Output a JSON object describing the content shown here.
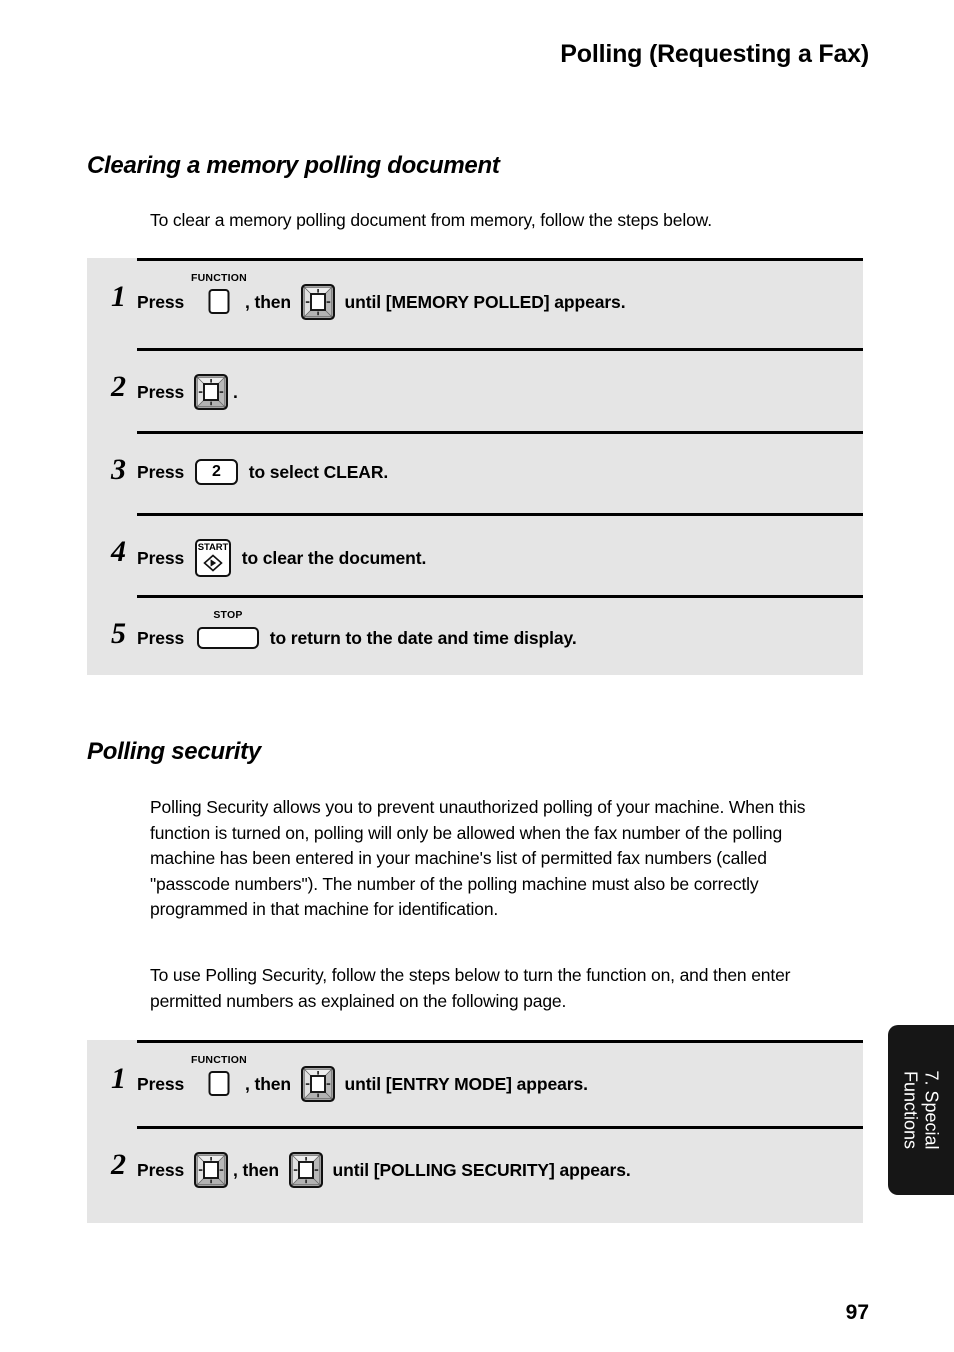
{
  "header": {
    "title": "Polling (Requesting a Fax)"
  },
  "sections": {
    "clearing": {
      "heading": "Clearing a memory polling document",
      "intro": "To clear a memory polling document from memory, follow the steps below.",
      "steps": [
        {
          "number": "1",
          "parts": [
            {
              "kind": "text",
              "value": "Press "
            },
            {
              "kind": "key",
              "icon": "function-key",
              "label": "FUNCTION"
            },
            {
              "kind": "text",
              "value": ", then "
            },
            {
              "kind": "key",
              "icon": "nav-key"
            },
            {
              "kind": "text",
              "value": " until [MEMORY POLLED] appears."
            }
          ]
        },
        {
          "number": "2",
          "parts": [
            {
              "kind": "text",
              "value": "Press "
            },
            {
              "kind": "key",
              "icon": "nav-key"
            },
            {
              "kind": "text",
              "value": "."
            }
          ]
        },
        {
          "number": "3",
          "parts": [
            {
              "kind": "text",
              "value": "Press "
            },
            {
              "kind": "key",
              "icon": "numeric-key",
              "label": "2"
            },
            {
              "kind": "text",
              "value": " to select CLEAR."
            }
          ]
        },
        {
          "number": "4",
          "parts": [
            {
              "kind": "text",
              "value": "Press "
            },
            {
              "kind": "key",
              "icon": "start-key",
              "label": "START"
            },
            {
              "kind": "text",
              "value": " to clear the document."
            }
          ]
        },
        {
          "number": "5",
          "parts": [
            {
              "kind": "text",
              "value": "Press "
            },
            {
              "kind": "key",
              "icon": "stop-key",
              "label": "STOP"
            },
            {
              "kind": "text",
              "value": " to return to the date and time display."
            }
          ]
        }
      ]
    },
    "security": {
      "heading": "Polling security",
      "paragraph1": "Polling Security allows you to prevent unauthorized polling of your machine. When this function is turned on, polling will only be allowed when the fax number of the polling machine has been entered in your machine's list of permitted fax numbers (called \"passcode numbers\"). The number of the polling machine must also be correctly programmed in that machine for identification.",
      "paragraph2": "To use Polling Security, follow the steps below to turn the function on, and then enter permitted numbers as explained on the following page.",
      "steps": [
        {
          "number": "1",
          "parts": [
            {
              "kind": "text",
              "value": "Press "
            },
            {
              "kind": "key",
              "icon": "function-key",
              "label": "FUNCTION"
            },
            {
              "kind": "text",
              "value": ", then "
            },
            {
              "kind": "key",
              "icon": "nav-key"
            },
            {
              "kind": "text",
              "value": " until [ENTRY MODE] appears."
            }
          ]
        },
        {
          "number": "2",
          "parts": [
            {
              "kind": "text",
              "value": "Press "
            },
            {
              "kind": "key",
              "icon": "nav-key"
            },
            {
              "kind": "text",
              "value": ", then "
            },
            {
              "kind": "key",
              "icon": "nav-key"
            },
            {
              "kind": "text",
              "value": " until [POLLING SECURITY] appears."
            }
          ]
        }
      ]
    }
  },
  "side_tab": {
    "line1": "7. Special",
    "line2": "Functions"
  },
  "footer": {
    "page_number": "97"
  },
  "colors": {
    "step_block_background": "#e5e5e5",
    "side_tab_background": "#161616",
    "text": "#000000",
    "page_background": "#ffffff"
  }
}
